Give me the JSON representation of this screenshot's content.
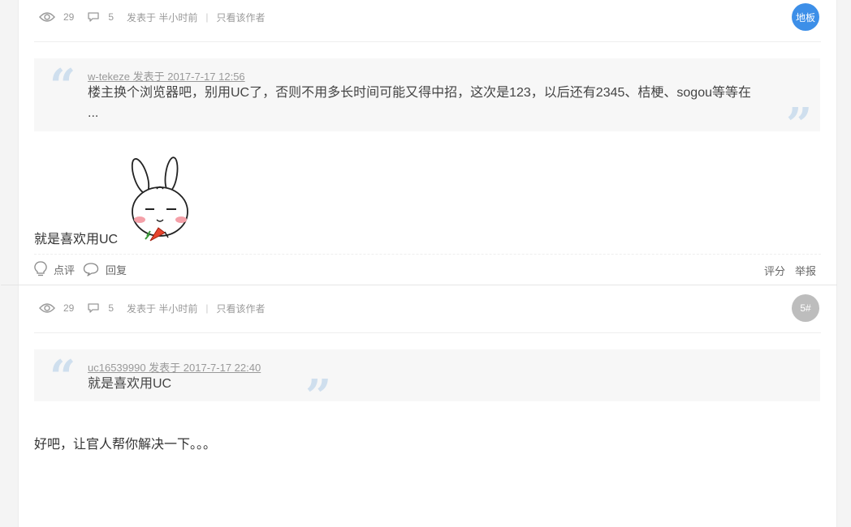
{
  "posts": [
    {
      "views": "29",
      "replies": "5",
      "posted": "发表于 半小时前",
      "only_author": "只看该作者",
      "floor": "地板",
      "floor_color": "#3d8fe8",
      "quote_author": "w-tekeze 发表于 2017-7-17 12:56",
      "quote_line1": "楼主换个浏览器吧，别用UC了，否则不用多长时间可能又得中招，这次是123，以后还有2345、桔梗、sogou等等在",
      "quote_line2": "...",
      "content": "就是喜欢用UC",
      "comment_label": "点评",
      "reply_label": "回复",
      "rate_label": "评分",
      "report_label": "举报"
    },
    {
      "views": "29",
      "replies": "5",
      "posted": "发表于 半小时前",
      "only_author": "只看该作者",
      "floor": "5#",
      "floor_color": "#bdbdbd",
      "quote_author": "uc16539990 发表于 2017-7-17 22:40",
      "quote_line1": "就是喜欢用UC",
      "content": "好吧，让官人帮你解决一下。。。"
    }
  ]
}
